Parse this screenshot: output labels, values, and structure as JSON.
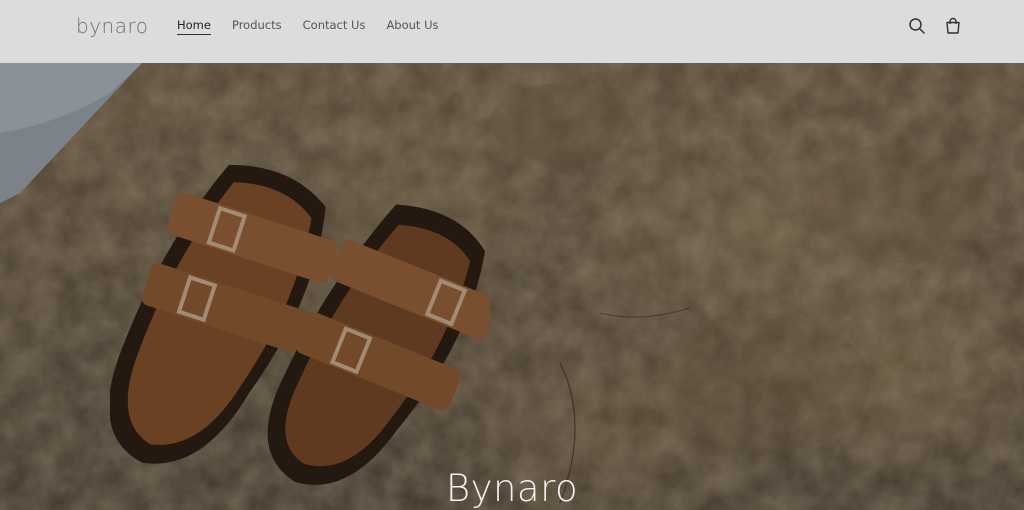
{
  "brand": {
    "logo_text": "bynaro"
  },
  "nav": {
    "items": [
      {
        "label": "Home",
        "active": true
      },
      {
        "label": "Products",
        "active": false
      },
      {
        "label": "Contact Us",
        "active": false
      },
      {
        "label": "About Us",
        "active": false
      }
    ]
  },
  "header_icons": {
    "search": "search-icon",
    "cart": "cart-icon"
  },
  "hero": {
    "title": "Bynaro"
  },
  "colors": {
    "header_bg": "#dcdcdc",
    "hero_text": "#f2f2f2",
    "sand": "#5a4a36"
  }
}
